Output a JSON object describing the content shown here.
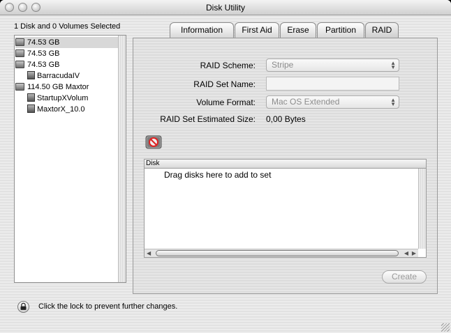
{
  "window": {
    "title": "Disk Utility"
  },
  "selection_summary": "1 Disk and 0 Volumes Selected",
  "sidebar": {
    "items": [
      {
        "label": "74.53 GB",
        "type": "disk",
        "selected": true
      },
      {
        "label": "74.53 GB",
        "type": "disk",
        "selected": false
      },
      {
        "label": "74.53 GB",
        "type": "disk",
        "selected": false
      },
      {
        "label": "BarracudaIV",
        "type": "volume",
        "selected": false
      },
      {
        "label": "114.50 GB Maxtor",
        "type": "disk",
        "selected": false
      },
      {
        "label": "StartupXVolum",
        "type": "volume",
        "selected": false
      },
      {
        "label": "MaxtorX_10.0",
        "type": "volume",
        "selected": false
      }
    ]
  },
  "tabs": [
    {
      "label": "Information",
      "active": false
    },
    {
      "label": "First Aid",
      "active": false
    },
    {
      "label": "Erase",
      "active": false
    },
    {
      "label": "Partition",
      "active": false
    },
    {
      "label": "RAID",
      "active": true
    }
  ],
  "raid": {
    "scheme_label": "RAID Scheme:",
    "scheme_value": "Stripe",
    "set_name_label": "RAID Set Name:",
    "set_name_value": "",
    "format_label": "Volume Format:",
    "format_value": "Mac OS Extended",
    "estimated_size_label": "RAID Set Estimated Size:",
    "estimated_size_value": "0,00 Bytes",
    "table_header": "Disk",
    "table_placeholder": "Drag disks here to add to set",
    "create_button": "Create"
  },
  "lock": {
    "text": "Click the lock to prevent further changes."
  },
  "colors": {
    "window_bg": "#ececec",
    "selection": "#d8d8d8",
    "disabled_text": "#8c8c8c"
  }
}
